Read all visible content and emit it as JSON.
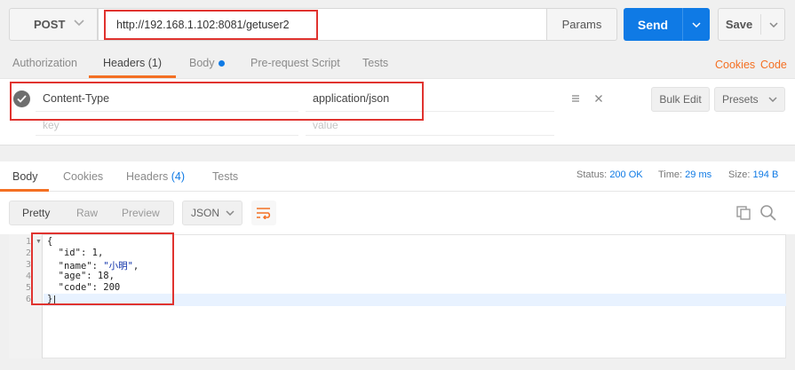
{
  "request": {
    "method": "POST",
    "url": "http://192.168.1.102:8081/getuser2",
    "params_label": "Params",
    "send_label": "Send",
    "save_label": "Save"
  },
  "request_tabs": {
    "authorization": "Authorization",
    "headers": "Headers (1)",
    "body": "Body",
    "pre_request": "Pre-request Script",
    "tests": "Tests",
    "cookies": "Cookies",
    "code": "Code"
  },
  "headers_table": {
    "row": {
      "key": "Content-Type",
      "value": "application/json"
    },
    "key_placeholder": "key",
    "value_placeholder": "value",
    "bulk_edit_label": "Bulk Edit",
    "presets_label": "Presets"
  },
  "response_tabs": {
    "body": "Body",
    "cookies": "Cookies",
    "headers": "Headers",
    "headers_count": "(4)",
    "tests": "Tests"
  },
  "response_status": {
    "status_label": "Status:",
    "status_value": "200 OK",
    "time_label": "Time:",
    "time_value": "29 ms",
    "size_label": "Size:",
    "size_value": "194 B"
  },
  "view": {
    "pretty": "Pretty",
    "raw": "Raw",
    "preview": "Preview",
    "format": "JSON"
  },
  "response_body": {
    "line_numbers": [
      "1",
      "2",
      "3",
      "4",
      "5",
      "6"
    ],
    "open_brace": "{",
    "close_brace": "}",
    "id_key": "\"id\"",
    "id_value": "1",
    "name_key": "\"name\"",
    "name_value": "\"小明\"",
    "age_key": "\"age\"",
    "age_value": "18",
    "code_key": "\"code\"",
    "code_value": "200"
  },
  "colors": {
    "accent": "#f47023",
    "send": "#0f7ae5",
    "highlight": "#e0332f"
  }
}
